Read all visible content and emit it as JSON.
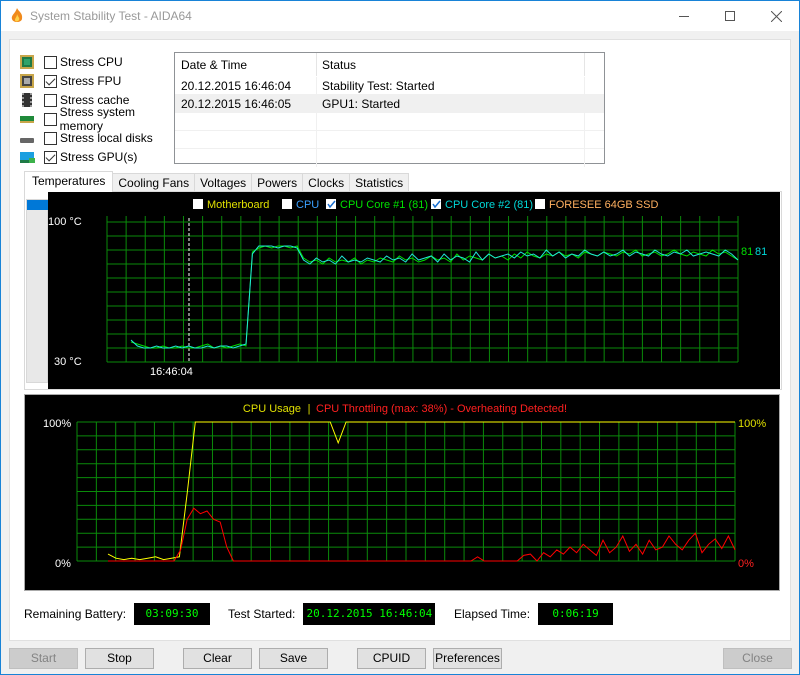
{
  "window": {
    "title": "System Stability Test - AIDA64",
    "controls": [
      "minimize",
      "maximize",
      "close"
    ]
  },
  "stress_options": [
    {
      "label": "Stress CPU",
      "checked": false,
      "icon": "cpu-icon"
    },
    {
      "label": "Stress FPU",
      "checked": true,
      "icon": "fpu-icon"
    },
    {
      "label": "Stress cache",
      "checked": false,
      "icon": "cache-chip-icon"
    },
    {
      "label": "Stress system memory",
      "checked": false,
      "icon": "memory-icon"
    },
    {
      "label": "Stress local disks",
      "checked": false,
      "icon": "disk-icon"
    },
    {
      "label": "Stress GPU(s)",
      "checked": true,
      "icon": "gpu-icon"
    }
  ],
  "log": {
    "columns": [
      "Date & Time",
      "Status"
    ],
    "rows": [
      {
        "datetime": "20.12.2015 16:46:04",
        "status": "Stability Test: Started"
      },
      {
        "datetime": "20.12.2015 16:46:05",
        "status": "GPU1: Started"
      }
    ]
  },
  "tabs": [
    "Temperatures",
    "Cooling Fans",
    "Voltages",
    "Powers",
    "Clocks",
    "Statistics"
  ],
  "active_tab": "Temperatures",
  "temperature_chart": {
    "legend": [
      {
        "label": "Motherboard",
        "checked": false,
        "color": "#e0e000"
      },
      {
        "label": "CPU",
        "checked": false,
        "color": "#3aa0ff"
      },
      {
        "label": "CPU Core #1 (81)",
        "checked": true,
        "color": "#00e000"
      },
      {
        "label": "CPU Core #2 (81)",
        "checked": true,
        "color": "#00d8d8"
      },
      {
        "label": "FORESEE 64GB SSD",
        "checked": false,
        "color": "#ffb060"
      }
    ],
    "y_max_label": "100 °C",
    "y_min_label": "30 °C",
    "x_marker_label": "16:46:04",
    "end_values": [
      "81",
      "81"
    ]
  },
  "cpu_chart": {
    "title_usage": "CPU Usage",
    "title_sep": "|",
    "title_throttle": "CPU Throttling (max: 38%) - Overheating Detected!",
    "y_max_left": "100%",
    "y_min_left": "0%",
    "y_max_right": "100%",
    "y_min_right": "0%",
    "usage_color": "#ffff00",
    "throttle_color": "#ff0000"
  },
  "chart_data": [
    {
      "type": "line",
      "title": "Temperatures",
      "ylabel": "°C",
      "ylim": [
        30,
        100
      ],
      "x_marker": "16:46:04",
      "series": [
        {
          "name": "CPU Core #1",
          "values": [
            40,
            39,
            38,
            37,
            37,
            38,
            37,
            37,
            38,
            37,
            37,
            38,
            39,
            37,
            38,
            37,
            38,
            39,
            38,
            85,
            87,
            88,
            87,
            88,
            88,
            87,
            88,
            82,
            80,
            81,
            79,
            82,
            80,
            81,
            80,
            82,
            79,
            81,
            80,
            82,
            81,
            80,
            83,
            81,
            82,
            80,
            81,
            83,
            81,
            82,
            80,
            84,
            81,
            83,
            82,
            81,
            84,
            82,
            83,
            81,
            84,
            82,
            85,
            83,
            82,
            84,
            83,
            85,
            83,
            84,
            82,
            85,
            84,
            83,
            85,
            84,
            83,
            85,
            84,
            86,
            83,
            84,
            85,
            83,
            84,
            86,
            84,
            83,
            85,
            84,
            83,
            86,
            84,
            85,
            83,
            81
          ]
        },
        {
          "name": "CPU Core #2",
          "values": [
            41,
            38,
            37,
            37,
            38,
            37,
            37,
            38,
            37,
            38,
            37,
            37,
            38,
            37,
            38,
            38,
            37,
            38,
            39,
            84,
            88,
            88,
            88,
            87,
            88,
            88,
            87,
            81,
            79,
            82,
            80,
            81,
            79,
            83,
            80,
            81,
            80,
            82,
            81,
            80,
            83,
            81,
            82,
            80,
            84,
            81,
            82,
            83,
            80,
            84,
            81,
            83,
            82,
            80,
            85,
            81,
            84,
            82,
            83,
            84,
            82,
            85,
            83,
            84,
            82,
            86,
            83,
            85,
            82,
            84,
            83,
            86,
            84,
            83,
            85,
            83,
            84,
            86,
            83,
            85,
            84,
            83,
            86,
            84,
            83,
            85,
            84,
            86,
            83,
            84,
            85,
            84,
            83,
            86,
            84,
            81
          ]
        }
      ],
      "final": {
        "CPU Core #1": 81,
        "CPU Core #2": 81
      }
    },
    {
      "type": "line",
      "title": "CPU Usage | CPU Throttling (max: 38%) - Overheating Detected!",
      "ylabel": "%",
      "ylim": [
        0,
        100
      ],
      "series": [
        {
          "name": "CPU Usage",
          "values": [
            5,
            2,
            1,
            2,
            1,
            2,
            3,
            1,
            2,
            3,
            50,
            100,
            100,
            100,
            100,
            100,
            100,
            100,
            100,
            100,
            100,
            100,
            100,
            100,
            100,
            100,
            100,
            100,
            100,
            85,
            100,
            100,
            100,
            100,
            100,
            100,
            100,
            100,
            100,
            100,
            100,
            100,
            100,
            100,
            100,
            100,
            100,
            100,
            100,
            100,
            100,
            100,
            100,
            100,
            100,
            100,
            100,
            100,
            100,
            100,
            100,
            100,
            100,
            100,
            100,
            100,
            100,
            100,
            100,
            100,
            100,
            100,
            100,
            100,
            100,
            100,
            100,
            100,
            100,
            100
          ]
        },
        {
          "name": "CPU Throttling",
          "values": [
            0,
            0,
            0,
            0,
            0,
            0,
            0,
            0,
            0,
            0,
            0,
            8,
            30,
            38,
            34,
            36,
            30,
            28,
            10,
            0,
            0,
            0,
            0,
            0,
            0,
            0,
            0,
            0,
            0,
            0,
            0,
            0,
            0,
            0,
            0,
            0,
            0,
            0,
            0,
            0,
            0,
            0,
            0,
            0,
            0,
            0,
            0,
            0,
            0,
            0,
            0,
            0,
            0,
            0,
            0,
            0,
            3,
            0,
            0,
            0,
            0,
            0,
            0,
            4,
            5,
            0,
            6,
            3,
            8,
            5,
            10,
            6,
            12,
            8,
            4,
            15,
            6,
            10,
            18,
            7,
            12,
            5,
            15,
            8,
            10,
            18,
            12,
            8,
            15,
            20,
            6,
            12,
            16,
            9,
            18,
            8
          ]
        }
      ],
      "max_throttle": 38
    }
  ],
  "status": {
    "remaining_battery_label": "Remaining Battery:",
    "remaining_battery": "03:09:30",
    "test_started_label": "Test Started:",
    "test_started": "20.12.2015 16:46:04",
    "elapsed_label": "Elapsed Time:",
    "elapsed": "0:06:19"
  },
  "buttons": {
    "start": "Start",
    "stop": "Stop",
    "clear": "Clear",
    "save": "Save",
    "cpuid": "CPUID",
    "preferences": "Preferences",
    "close": "Close"
  }
}
